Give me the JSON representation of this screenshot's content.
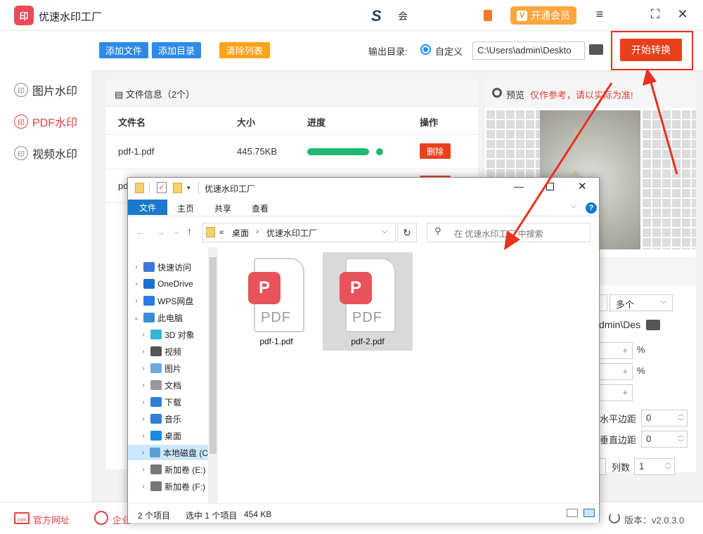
{
  "app": {
    "logo": "印",
    "title": "优速水印工厂",
    "header_mark": "S",
    "header_text": "会",
    "vip_icon": "V",
    "vip_label": "开通会员",
    "icons": [
      "menu-icon",
      "maximize-icon",
      "close-icon"
    ]
  },
  "sidebar": {
    "items": [
      {
        "ring": "印",
        "label": "图片水印"
      },
      {
        "ring": "印",
        "label": "PDF水印"
      },
      {
        "ring": "印",
        "label": "视频水印"
      }
    ]
  },
  "toolbar": {
    "add_file": "添加文件",
    "add_dir": "添加目录",
    "clear_list": "清除列表",
    "output_label": "输出目录:",
    "custom_label": "自定义",
    "output_path": "C:\\Users\\admin\\Deskto",
    "start_button": "开始转换"
  },
  "file_panel": {
    "title": "文件信息（2个）",
    "columns": [
      "文件名",
      "大小",
      "进度",
      "操作"
    ],
    "rows": [
      {
        "name": "pdf-1.pdf",
        "size": "445.75KB",
        "progress": 1.0,
        "action": "删除"
      },
      {
        "name": "pd",
        "size": "",
        "progress": 0,
        "action": ""
      }
    ]
  },
  "preview": {
    "label": "预览",
    "warning": "仅作参考，请以实际为准!",
    "watermark_text": "Bank",
    "mode_select": "多个",
    "path_partial": "dmin\\Des",
    "pct1": "%",
    "pct2": "%",
    "plus": "+",
    "h_margin_label": "水平边距",
    "h_margin_value": "0",
    "v_margin_label": "垂直边距",
    "v_margin_value": "0",
    "cols_label": "列数",
    "cols_value": "1"
  },
  "footer": {
    "site_icon": "com",
    "site_label": "官方网址",
    "qq_label": "企业",
    "version": "版本：v2.0.3.0"
  },
  "explorer": {
    "title": "优速水印工厂",
    "tabs": [
      "文件",
      "主页",
      "共享",
      "查看"
    ],
    "address": {
      "prefix": "«",
      "parts": [
        "桌面",
        "优速水印工厂"
      ]
    },
    "search_placeholder": "在 优速水印工厂 中搜索",
    "tree": [
      {
        "label": "快速访问",
        "indent": 0,
        "arrow": ">",
        "icon": "#3c78d8"
      },
      {
        "label": "OneDrive",
        "indent": 0,
        "arrow": ">",
        "icon": "#1e6fd0"
      },
      {
        "label": "WPS网盘",
        "indent": 0,
        "arrow": ">",
        "icon": "#2a7be4"
      },
      {
        "label": "此电脑",
        "indent": 0,
        "arrow": "v",
        "icon": "#3b8ad8"
      },
      {
        "label": "3D 对象",
        "indent": 1,
        "arrow": ">",
        "icon": "#39b3d7"
      },
      {
        "label": "视频",
        "indent": 1,
        "arrow": ">",
        "icon": "#555555"
      },
      {
        "label": "图片",
        "indent": 1,
        "arrow": ">",
        "icon": "#6fa8dc"
      },
      {
        "label": "文档",
        "indent": 1,
        "arrow": ">",
        "icon": "#999999"
      },
      {
        "label": "下载",
        "indent": 1,
        "arrow": ">",
        "icon": "#2f7fd6"
      },
      {
        "label": "音乐",
        "indent": 1,
        "arrow": ">",
        "icon": "#2f7fd6"
      },
      {
        "label": "桌面",
        "indent": 1,
        "arrow": ">",
        "icon": "#1a8ce0"
      },
      {
        "label": "本地磁盘 (C",
        "indent": 1,
        "arrow": ">",
        "icon": "#5aa0d8",
        "selected": true
      },
      {
        "label": "新加卷 (E:)",
        "indent": 1,
        "arrow": ">",
        "icon": "#777777"
      },
      {
        "label": "新加卷 (F:)",
        "indent": 1,
        "arrow": ">",
        "icon": "#777777"
      }
    ],
    "files": [
      {
        "name": "pdf-1.pdf",
        "badge": "P",
        "type_label": "PDF",
        "selected": false
      },
      {
        "name": "pdf-2.pdf",
        "badge": "P",
        "type_label": "PDF",
        "selected": true
      }
    ],
    "status": {
      "count": "2 个项目",
      "selected": "选中 1 个项目",
      "size": "454 KB"
    }
  },
  "colors": {
    "accent_red": "#e8401c",
    "blue": "#2e8ae8",
    "orange": "#ffa63d",
    "progress_green": "#1fb870"
  }
}
